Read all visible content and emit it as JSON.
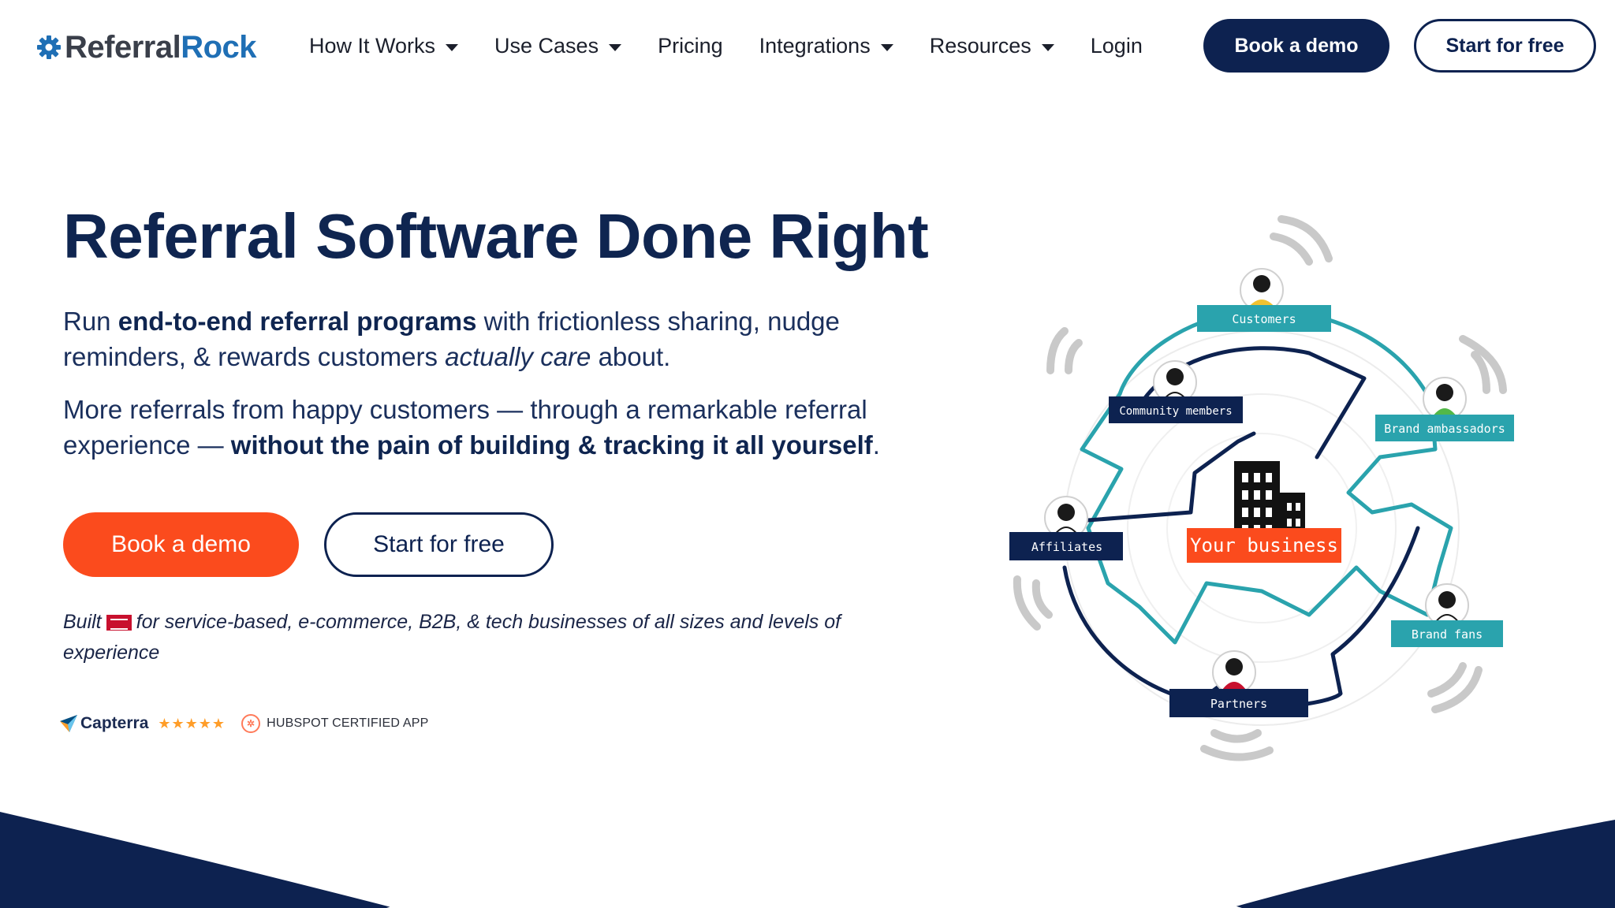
{
  "nav": {
    "logo": {
      "part1": "Referral",
      "part2": "Rock"
    },
    "menu": [
      {
        "label": "How It Works",
        "has_dropdown": true
      },
      {
        "label": "Use Cases",
        "has_dropdown": true
      },
      {
        "label": "Pricing",
        "has_dropdown": false
      },
      {
        "label": "Integrations",
        "has_dropdown": true
      },
      {
        "label": "Resources",
        "has_dropdown": true
      },
      {
        "label": "Login",
        "has_dropdown": false
      }
    ],
    "book_demo": "Book a demo",
    "start_free": "Start for free"
  },
  "hero": {
    "title": "Referral Software Done Right",
    "p1": {
      "a": "Run ",
      "b": "end-to-end referral programs",
      "c": " with frictionless sharing, nudge reminders, & rewards customers ",
      "d": "actually care",
      "e": " about."
    },
    "p2": {
      "a": "More referrals from happy customers — through a remarkable referral experience — ",
      "b": "without the pain of building & tracking it all yourself",
      "c": "."
    },
    "book_demo": "Book a demo",
    "start_free": "Start for free",
    "built": {
      "a": "Built",
      "b": "for service-based, e-commerce, B2B, & tech businesses of all sizes and levels of experience"
    },
    "badges": {
      "capterra": "Capterra",
      "capterra_stars": "★★★★★",
      "hubspot": "HUBSPOT CERTIFIED APP"
    }
  },
  "diagram": {
    "center_label": "Your business",
    "nodes": {
      "customers": "Customers",
      "community": "Community members",
      "ambassadors": "Brand ambassadors",
      "affiliates": "Affiliates",
      "fans": "Brand fans",
      "partners": "Partners"
    }
  },
  "colors": {
    "navy": "#0d2250",
    "orange": "#fb4b1d",
    "teal": "#2aa3ad",
    "logo_blue": "#1f6fb5"
  }
}
